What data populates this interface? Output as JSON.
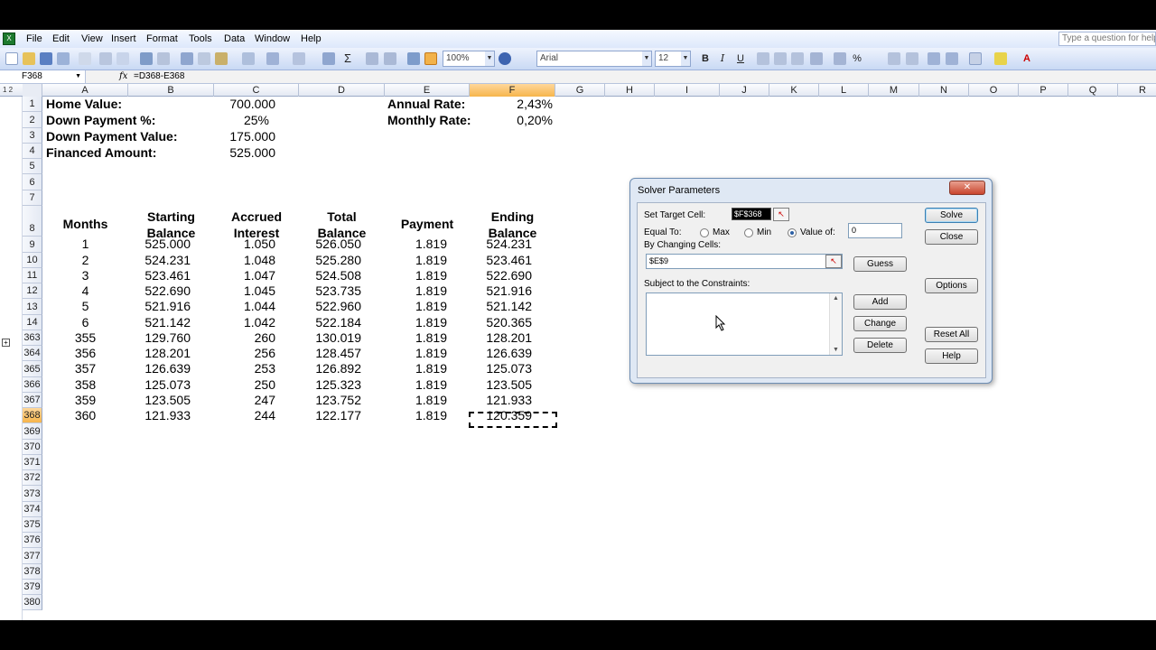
{
  "menu": {
    "items": [
      "File",
      "Edit",
      "View",
      "Insert",
      "Format",
      "Tools",
      "Data",
      "Window",
      "Help"
    ],
    "help_box": "Type a question for help"
  },
  "toolbar": {
    "zoom": "100%",
    "font": "Arial",
    "size": "12"
  },
  "formula_bar": {
    "name_box": "F368",
    "fx": "fx",
    "formula": "=D368-E368"
  },
  "outline_levels": "1 2",
  "columns": [
    "A",
    "B",
    "C",
    "D",
    "E",
    "F",
    "G",
    "H",
    "I",
    "J",
    "K",
    "L",
    "M",
    "N",
    "O",
    "P",
    "Q",
    "R"
  ],
  "rows": [
    "1",
    "2",
    "3",
    "4",
    "5",
    "6",
    "7",
    "8",
    "9",
    "10",
    "11",
    "12",
    "13",
    "14",
    "363",
    "364",
    "365",
    "366",
    "367",
    "368",
    "369",
    "370",
    "371",
    "372",
    "373",
    "374",
    "375",
    "376",
    "377",
    "378",
    "379",
    "380"
  ],
  "summary": {
    "home_value_label": "Home Value:",
    "home_value": "700.000",
    "down_pct_label": "Down Payment %:",
    "down_pct": "25%",
    "down_value_label": "Down Payment Value:",
    "down_value": "175.000",
    "financed_label": "Financed Amount:",
    "financed": "525.000",
    "annual_rate_label": "Annual Rate:",
    "annual_rate": "2,43%",
    "monthly_rate_label": "Monthly Rate:",
    "monthly_rate": "0,20%"
  },
  "table": {
    "headers": {
      "months": "Months",
      "start1": "Starting",
      "start2": "Balance",
      "acc1": "Accrued",
      "acc2": "Interest",
      "tot1": "Total",
      "tot2": "Balance",
      "payment": "Payment",
      "end1": "Ending",
      "end2": "Balance"
    },
    "rows": [
      [
        "1",
        "525.000",
        "1.050",
        "526.050",
        "1.819",
        "524.231"
      ],
      [
        "2",
        "524.231",
        "1.048",
        "525.280",
        "1.819",
        "523.461"
      ],
      [
        "3",
        "523.461",
        "1.047",
        "524.508",
        "1.819",
        "522.690"
      ],
      [
        "4",
        "522.690",
        "1.045",
        "523.735",
        "1.819",
        "521.916"
      ],
      [
        "5",
        "521.916",
        "1.044",
        "522.960",
        "1.819",
        "521.142"
      ],
      [
        "6",
        "521.142",
        "1.042",
        "522.184",
        "1.819",
        "520.365"
      ],
      [
        "355",
        "129.760",
        "260",
        "130.019",
        "1.819",
        "128.201"
      ],
      [
        "356",
        "128.201",
        "256",
        "128.457",
        "1.819",
        "126.639"
      ],
      [
        "357",
        "126.639",
        "253",
        "126.892",
        "1.819",
        "125.073"
      ],
      [
        "358",
        "125.073",
        "250",
        "125.323",
        "1.819",
        "123.505"
      ],
      [
        "359",
        "123.505",
        "247",
        "123.752",
        "1.819",
        "121.933"
      ],
      [
        "360",
        "121.933",
        "244",
        "122.177",
        "1.819",
        "120.359"
      ]
    ]
  },
  "dialog": {
    "title": "Solver Parameters",
    "close": "✕",
    "target_label": "Set Target Cell:",
    "target_value": "$F$368",
    "equal_label": "Equal To:",
    "max": "Max",
    "min": "Min",
    "value_of": "Value of:",
    "value": "0",
    "changing_label": "By Changing Cells:",
    "changing_value": "$E$9",
    "constraints_label": "Subject to the Constraints:",
    "buttons": {
      "solve": "Solve",
      "close": "Close",
      "options": "Options",
      "guess": "Guess",
      "add": "Add",
      "change": "Change",
      "delete": "Delete",
      "reset": "Reset All",
      "help": "Help"
    }
  }
}
